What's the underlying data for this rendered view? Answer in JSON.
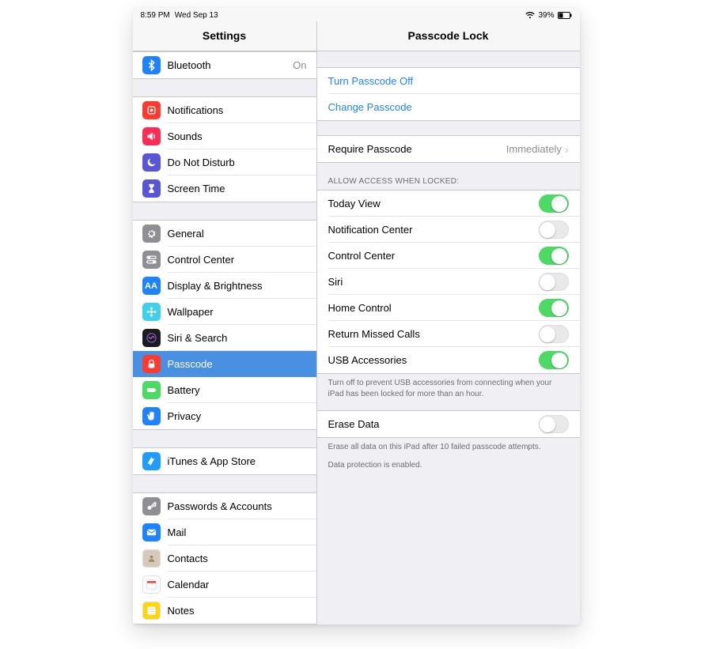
{
  "status": {
    "time": "8:59 PM",
    "date": "Wed Sep 13",
    "battery_pct": "39%"
  },
  "left": {
    "title": "Settings",
    "groups": [
      [
        {
          "id": "bluetooth",
          "label": "Bluetooth",
          "value": "On",
          "icon": "bluetooth",
          "color": "#1f82ff"
        }
      ],
      [
        {
          "id": "notifications",
          "label": "Notifications",
          "icon": "bell",
          "color": "#ff3b30"
        },
        {
          "id": "sounds",
          "label": "Sounds",
          "icon": "speaker",
          "color": "#ff2d55"
        },
        {
          "id": "dnd",
          "label": "Do Not Disturb",
          "icon": "moon",
          "color": "#5856d6"
        },
        {
          "id": "screentime",
          "label": "Screen Time",
          "icon": "hourglass",
          "color": "#5856d6"
        }
      ],
      [
        {
          "id": "general",
          "label": "General",
          "icon": "gear",
          "color": "#8e8e93"
        },
        {
          "id": "controlcenter",
          "label": "Control Center",
          "icon": "switches",
          "color": "#8e8e93"
        },
        {
          "id": "display",
          "label": "Display & Brightness",
          "icon": "aa",
          "color": "#1f82ff"
        },
        {
          "id": "wallpaper",
          "label": "Wallpaper",
          "icon": "flower",
          "color": "#3fcfef"
        },
        {
          "id": "siri",
          "label": "Siri & Search",
          "icon": "siri",
          "color": "#1c1c1e"
        },
        {
          "id": "passcode",
          "label": "Passcode",
          "icon": "lock",
          "color": "#ff3b30",
          "selected": true
        },
        {
          "id": "battery",
          "label": "Battery",
          "icon": "battery",
          "color": "#4cd964"
        },
        {
          "id": "privacy",
          "label": "Privacy",
          "icon": "hand",
          "color": "#1f82ff"
        }
      ],
      [
        {
          "id": "itunes",
          "label": "iTunes & App Store",
          "icon": "appstore",
          "color": "#1f9dff"
        }
      ],
      [
        {
          "id": "passwords",
          "label": "Passwords & Accounts",
          "icon": "key",
          "color": "#8e8e93"
        },
        {
          "id": "mail",
          "label": "Mail",
          "icon": "mail",
          "color": "#1f82ff"
        },
        {
          "id": "contacts",
          "label": "Contacts",
          "icon": "contacts",
          "color": "#d6c9b8"
        },
        {
          "id": "calendar",
          "label": "Calendar",
          "icon": "calendar",
          "color": "#ffffff"
        },
        {
          "id": "notes",
          "label": "Notes",
          "icon": "notes",
          "color": "#ffd60a"
        }
      ]
    ]
  },
  "right": {
    "title": "Passcode Lock",
    "action_links": [
      {
        "id": "turnoff",
        "label": "Turn Passcode Off"
      },
      {
        "id": "change",
        "label": "Change Passcode"
      }
    ],
    "require": {
      "label": "Require Passcode",
      "value": "Immediately"
    },
    "access_header": "Allow Access When Locked:",
    "access_toggles": [
      {
        "id": "today",
        "label": "Today View",
        "on": true
      },
      {
        "id": "notif",
        "label": "Notification Center",
        "on": false
      },
      {
        "id": "cc",
        "label": "Control Center",
        "on": true
      },
      {
        "id": "sirit",
        "label": "Siri",
        "on": false
      },
      {
        "id": "home",
        "label": "Home Control",
        "on": true
      },
      {
        "id": "missed",
        "label": "Return Missed Calls",
        "on": false
      },
      {
        "id": "usb",
        "label": "USB Accessories",
        "on": true
      }
    ],
    "access_footer": "Turn off to prevent USB accessories from connecting when your iPad has been locked for more than an hour.",
    "erase": {
      "label": "Erase Data",
      "on": false
    },
    "erase_footer": "Erase all data on this iPad after 10 failed passcode attempts.",
    "protection_footer": "Data protection is enabled."
  }
}
